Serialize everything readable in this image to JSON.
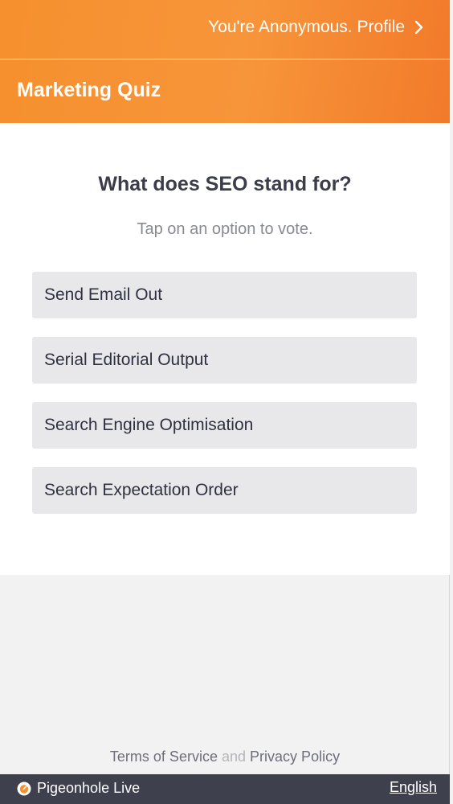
{
  "header": {
    "profile_text": "You're Anonymous. Profile",
    "title": "Marketing Quiz"
  },
  "poll": {
    "question": "What does SEO stand for?",
    "hint": "Tap on an option to vote.",
    "options": [
      {
        "label": "Send Email Out"
      },
      {
        "label": "Serial Editorial Output"
      },
      {
        "label": "Search Engine Optimisation"
      },
      {
        "label": "Search Expectation Order"
      }
    ]
  },
  "footer": {
    "terms": "Terms of Service",
    "and": "and",
    "privacy": "Privacy Policy",
    "brand": "Pigeonhole Live",
    "language": "English"
  },
  "icons": {
    "profile_chevron": "chevron-right-icon",
    "brand_logo": "pigeonhole-logo-icon"
  },
  "colors": {
    "accent": "#f6902e",
    "option_bg": "#e8e8ea",
    "bottombar": "#3e404e"
  }
}
